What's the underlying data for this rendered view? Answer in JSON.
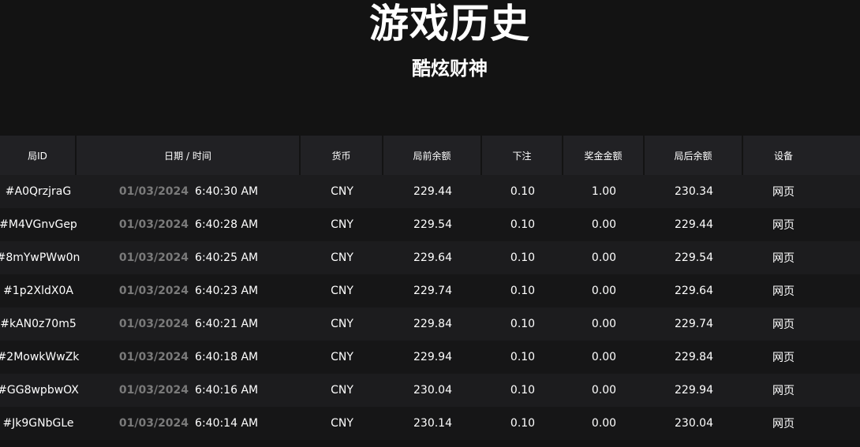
{
  "page": {
    "title": "游戏历史",
    "subtitle": "酷炫财神"
  },
  "table": {
    "headers": {
      "round_id": "局ID",
      "datetime": "日期 / 时间",
      "currency": "货币",
      "balance_before": "局前余额",
      "bet": "下注",
      "prize": "奖金金额",
      "balance_after": "局后余额",
      "device": "设备"
    },
    "rows": [
      {
        "id": "#A0QrzjraG",
        "date": "01/03/2024",
        "time": "6:40:30 AM",
        "currency": "CNY",
        "before": "229.44",
        "bet": "0.10",
        "prize": "1.00",
        "after": "230.34",
        "device": "网页"
      },
      {
        "id": "#M4VGnvGep",
        "date": "01/03/2024",
        "time": "6:40:28 AM",
        "currency": "CNY",
        "before": "229.54",
        "bet": "0.10",
        "prize": "0.00",
        "after": "229.44",
        "device": "网页"
      },
      {
        "id": "#8mYwPWw0n",
        "date": "01/03/2024",
        "time": "6:40:25 AM",
        "currency": "CNY",
        "before": "229.64",
        "bet": "0.10",
        "prize": "0.00",
        "after": "229.54",
        "device": "网页"
      },
      {
        "id": "#1p2XldX0A",
        "date": "01/03/2024",
        "time": "6:40:23 AM",
        "currency": "CNY",
        "before": "229.74",
        "bet": "0.10",
        "prize": "0.00",
        "after": "229.64",
        "device": "网页"
      },
      {
        "id": "#kAN0z70m5",
        "date": "01/03/2024",
        "time": "6:40:21 AM",
        "currency": "CNY",
        "before": "229.84",
        "bet": "0.10",
        "prize": "0.00",
        "after": "229.74",
        "device": "网页"
      },
      {
        "id": "#2MowkWwZk",
        "date": "01/03/2024",
        "time": "6:40:18 AM",
        "currency": "CNY",
        "before": "229.94",
        "bet": "0.10",
        "prize": "0.00",
        "after": "229.84",
        "device": "网页"
      },
      {
        "id": "#GG8wpbwOX",
        "date": "01/03/2024",
        "time": "6:40:16 AM",
        "currency": "CNY",
        "before": "230.04",
        "bet": "0.10",
        "prize": "0.00",
        "after": "229.94",
        "device": "网页"
      },
      {
        "id": "#Jk9GNbGLe",
        "date": "01/03/2024",
        "time": "6:40:14 AM",
        "currency": "CNY",
        "before": "230.14",
        "bet": "0.10",
        "prize": "0.00",
        "after": "230.04",
        "device": "网页"
      }
    ]
  }
}
